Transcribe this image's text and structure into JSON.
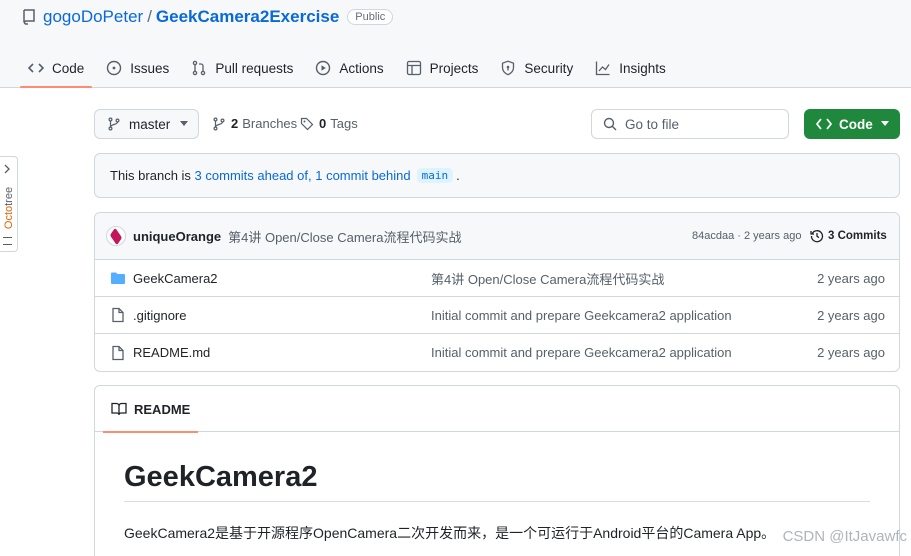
{
  "repo": {
    "owner": "gogoDoPeter",
    "separator": "/",
    "name": "GeekCamera2Exercise",
    "visibility": "Public"
  },
  "tabs": [
    {
      "label": "Code",
      "icon": "code-icon",
      "active": true
    },
    {
      "label": "Issues",
      "icon": "issue-icon"
    },
    {
      "label": "Pull requests",
      "icon": "pull-request-icon"
    },
    {
      "label": "Actions",
      "icon": "play-icon"
    },
    {
      "label": "Projects",
      "icon": "table-icon"
    },
    {
      "label": "Security",
      "icon": "shield-icon"
    },
    {
      "label": "Insights",
      "icon": "graph-icon"
    }
  ],
  "octotree": {
    "label_a": "Octo",
    "label_b": "tree"
  },
  "toolbar": {
    "branch": "master",
    "branches_count": "2",
    "branches_label": "Branches",
    "tags_count": "0",
    "tags_label": "Tags",
    "goto_placeholder": "Go to file",
    "code_button": "Code"
  },
  "notice": {
    "prefix": "This branch is",
    "ahead": "3 commits ahead of,",
    "behind": "1 commit behind",
    "base": "main",
    "suffix": "."
  },
  "latest_commit": {
    "author": "uniqueOrange",
    "message": "第4讲 Open/Close Camera流程代码实战",
    "meta": "84acdaa · 2 years ago",
    "commits_label": "3 Commits"
  },
  "files": [
    {
      "type": "folder",
      "name": "GeekCamera2",
      "message": "第4讲 Open/Close Camera流程代码实战",
      "age": "2 years ago"
    },
    {
      "type": "file",
      "name": ".gitignore",
      "message": "Initial commit and prepare Geekcamera2 application",
      "age": "2 years ago"
    },
    {
      "type": "file",
      "name": "README.md",
      "message": "Initial commit and prepare Geekcamera2 application",
      "age": "2 years ago"
    }
  ],
  "readme": {
    "tab_label": "README",
    "heading": "GeekCamera2",
    "paragraph": "GeekCamera2是基于开源程序OpenCamera二次开发而来，是一个可运行于Android平台的Camera App。"
  },
  "watermark": "CSDN @ItJavawfc",
  "colors": {
    "accent": "#0969da",
    "primary_button": "#1f883d",
    "active_tab": "#fd8c73"
  }
}
